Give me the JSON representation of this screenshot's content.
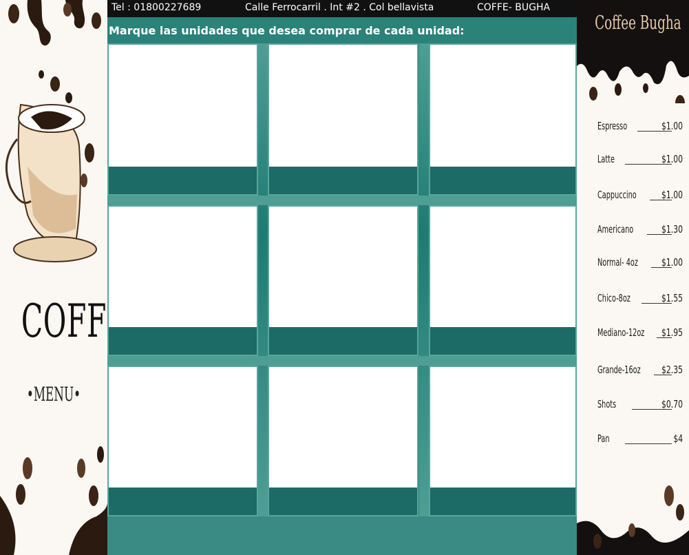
{
  "header": {
    "tel": "Tel : 01800227689",
    "address": "Calle Ferrocarril . Int #2 . Col bellavista",
    "brand": "COFFE- BUGHA"
  },
  "main": {
    "instruction": "Marque las unidades que desea comprar de cada unidad:"
  },
  "left_panel": {
    "title": "COFFEE",
    "subtitle": "•MENU•"
  },
  "menu": {
    "title": "Coffee Bugha",
    "items": [
      {
        "name": "Espresso",
        "price": "$1.00"
      },
      {
        "name": "Latte",
        "price": "$1.00"
      },
      {
        "name": "Cappuccino",
        "price": "$1.00"
      },
      {
        "name": "Americano",
        "price": "$1.30"
      },
      {
        "name": "Normal- 4oz",
        "price": "$1.00"
      },
      {
        "name": "Chico-8oz",
        "price": "$1.55"
      },
      {
        "name": "Mediano-12oz",
        "price": "$1.95"
      },
      {
        "name": "Grande-16oz",
        "price": "$2.35"
      },
      {
        "name": "Shots",
        "price": "$0.70"
      },
      {
        "name": "Pan",
        "price": "$4"
      }
    ]
  },
  "colors": {
    "teal": "#2a8279",
    "card_bar": "#1d6b66",
    "header_bg": "#111111",
    "menu_title": "#e8c9a0"
  }
}
